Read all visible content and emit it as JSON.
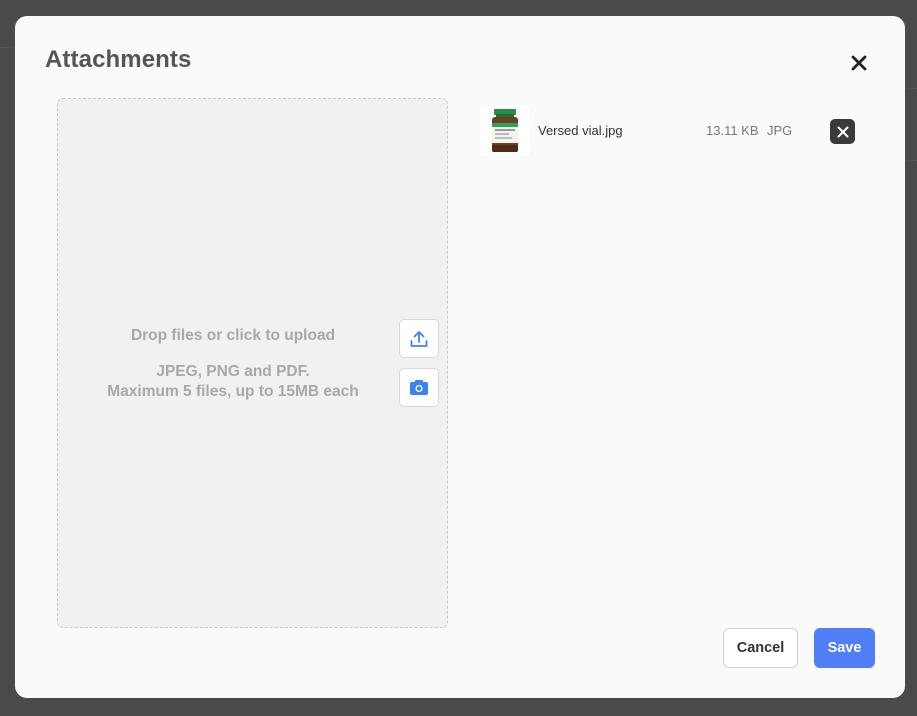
{
  "modal": {
    "title": "Attachments",
    "close_icon": "close-icon"
  },
  "dropzone": {
    "primary_text": "Drop files or click to upload",
    "formats_text": "JPEG, PNG and PDF.",
    "limits_text": "Maximum 5 files, up to 15MB each",
    "upload_icon": "upload-icon",
    "camera_icon": "camera-icon"
  },
  "files": [
    {
      "name": "Versed vial.jpg",
      "size": "13.11 KB",
      "type": "JPG",
      "remove_icon": "close-icon"
    }
  ],
  "actions": {
    "cancel_label": "Cancel",
    "save_label": "Save"
  },
  "colors": {
    "primary": "#4f7ef7",
    "icon_blue": "#3b82f6",
    "remove_bg": "#3a3a3a",
    "backdrop": "#4a4a4a"
  }
}
